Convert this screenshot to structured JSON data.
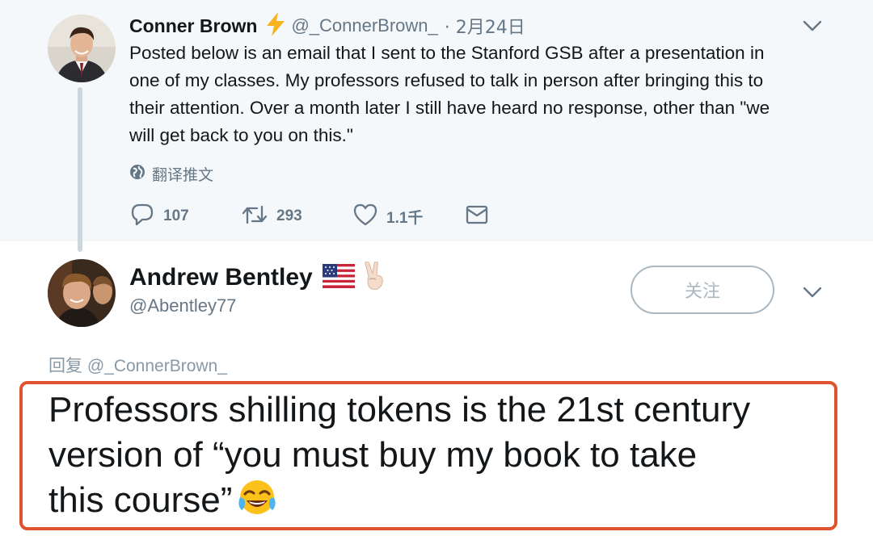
{
  "parent_tweet": {
    "author_name": "Conner Brown",
    "author_handle": "@_ConnerBrown_",
    "date": "· 2月24日",
    "text_lines": [
      "Posted below is an email that I sent to the Stanford GSB after a presentation in",
      "one of my classes. My professors refused to talk in person after bringing this to",
      "their attention. Over a month later I still have heard no response, other than \"we",
      "will get back to you on this.\""
    ],
    "translate_label": "翻译推文",
    "actions": {
      "reply_count": "107",
      "retweet_count": "293",
      "like_count": "1.1千"
    },
    "icons": {
      "name_emoji": "lightning-bolt-icon",
      "translate": "globe-icon",
      "reply": "reply-icon",
      "retweet": "retweet-icon",
      "like": "heart-icon",
      "dm": "envelope-icon",
      "menu": "chevron-down-icon"
    }
  },
  "reply_tweet": {
    "author_name": "Andrew Bentley",
    "author_handle": "@Abentley77",
    "name_emojis": [
      "us-flag-icon",
      "victory-hand-icon"
    ],
    "follow_label": "关注",
    "reply_to_prefix": "回复",
    "reply_to_handle": "@_ConnerBrown_",
    "text_lines": [
      "Professors shilling tokens is the 21st century",
      "version of “you must buy my book to take",
      "this course”"
    ],
    "text_emoji": "tears-of-joy-icon"
  },
  "colors": {
    "parent_background": "#f5f8fa",
    "secondary_text": "#657786",
    "highlight_border": "#e0532f",
    "follow_border": "#aab8c2"
  }
}
